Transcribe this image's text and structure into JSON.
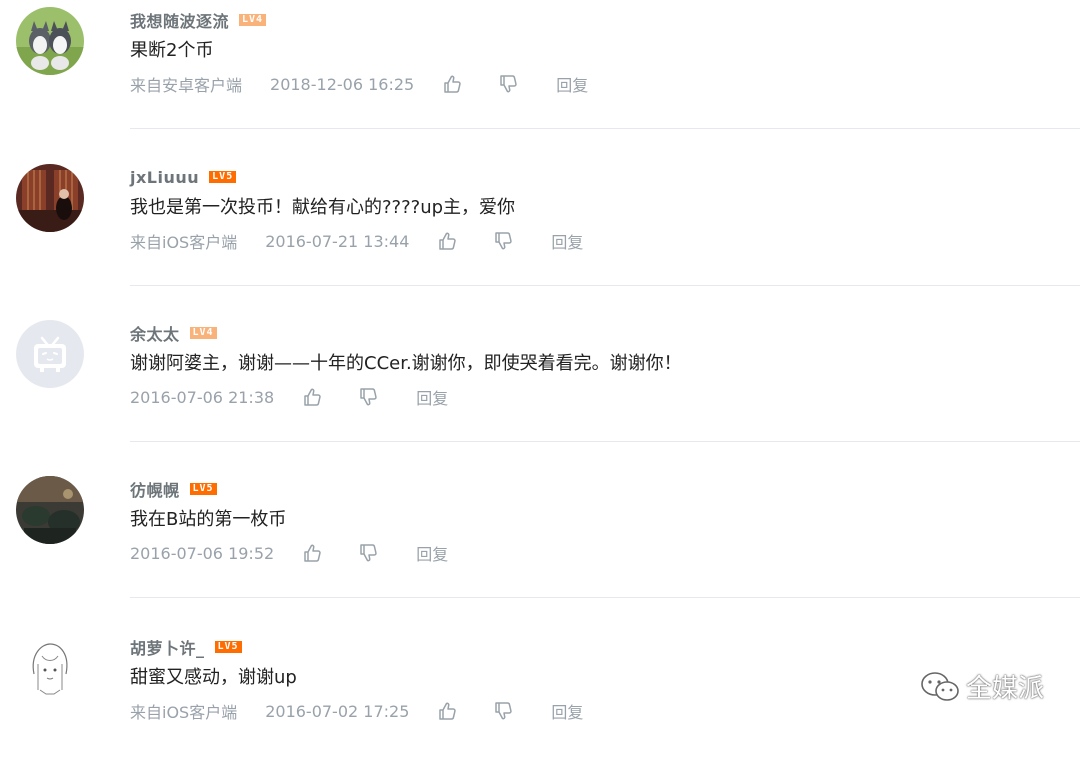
{
  "comments": [
    {
      "username": "我想随波逐流",
      "level": "LV4",
      "text": "果断2个币",
      "source": "来自安卓客户端",
      "time": "2018-12-06 16:25",
      "reply": "回复",
      "avatar": "husky-puppies-avatar"
    },
    {
      "username": "jxLiuuu",
      "level": "LV5",
      "text": "我也是第一次投币！献给有心的????up主，爱你",
      "source": "来自iOS客户端",
      "time": "2016-07-21 13:44",
      "reply": "回复",
      "avatar": "dim-room-photo-avatar"
    },
    {
      "username": "余太太",
      "level": "LV4",
      "text": "谢谢阿婆主，谢谢——十年的CCer.谢谢你，即使哭着看完。谢谢你！",
      "source": "",
      "time": "2016-07-06 21:38",
      "reply": "回复",
      "avatar": "default-tv-avatar"
    },
    {
      "username": "彷幌幌",
      "level": "LV5",
      "text": "我在B站的第一枚币",
      "source": "",
      "time": "2016-07-06 19:52",
      "reply": "回复",
      "avatar": "dark-scene-avatar"
    },
    {
      "username": "胡萝卜许_",
      "level": "LV5",
      "text": "甜蜜又感动，谢谢up",
      "source": "来自iOS客户端",
      "time": "2016-07-02 17:25",
      "reply": "回复",
      "avatar": "sketch-girl-avatar"
    }
  ],
  "watermark": {
    "text": "全媒派",
    "icon": "wechat-icon"
  },
  "colors": {
    "username": "#6d757a",
    "text": "#222222",
    "meta": "#99a2aa",
    "lv4": "#fab27b",
    "lv5": "#ff6c00",
    "divider": "#e5e9ef"
  }
}
